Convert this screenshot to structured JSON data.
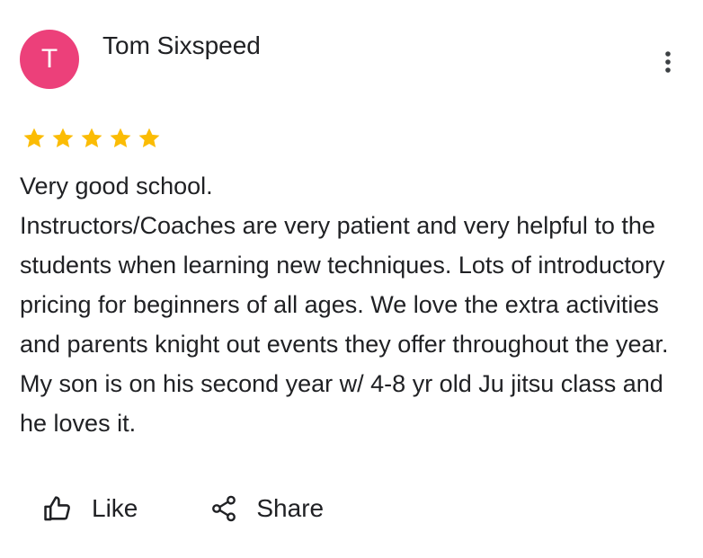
{
  "review": {
    "author": {
      "initial": "T",
      "name": "Tom Sixspeed",
      "avatar_color": "#ec407a"
    },
    "rating": {
      "value": 5,
      "max": 5,
      "star_color": "#fbbc04"
    },
    "text": {
      "line1": "Very good school.",
      "line2": "Instructors/Coaches are very patient and very helpful to the students when learning new techniques. Lots of introductory pricing for beginners of all ages. We love the extra activities and parents knight out events they offer throughout the year. My son is on his second year w/ 4-8 yr old Ju jitsu class and he loves it."
    },
    "actions": {
      "like_label": "Like",
      "like_icon": "thumbs-up-icon",
      "share_label": "Share",
      "share_icon": "share-icon"
    },
    "menu_icon": "more-vertical-icon"
  }
}
